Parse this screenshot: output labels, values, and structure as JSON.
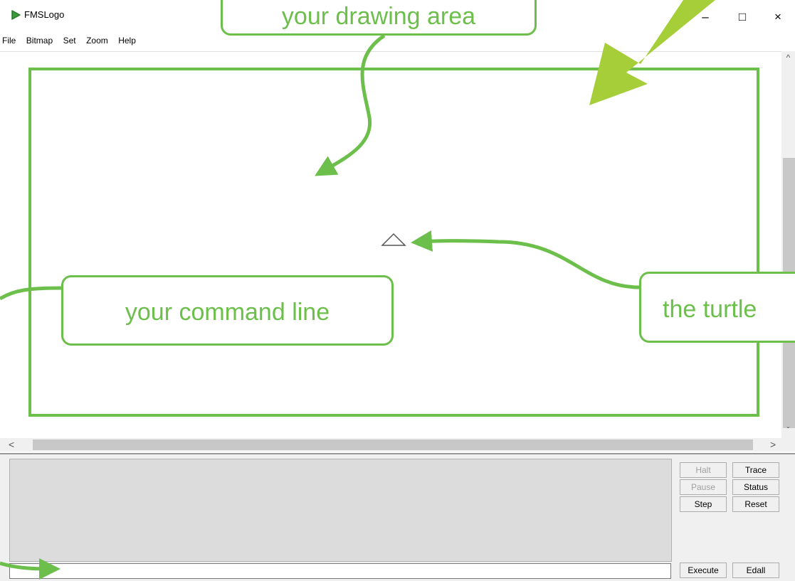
{
  "window": {
    "title": "FMSLogo",
    "controls": {
      "minimize": "–",
      "maximize": "□",
      "close": "×"
    }
  },
  "menu": [
    "File",
    "Bitmap",
    "Set",
    "Zoom",
    "Help"
  ],
  "scrollbars": {
    "up": "^",
    "down": "ˇ",
    "left": "<",
    "right": ">"
  },
  "commander": {
    "input_value": "",
    "buttons": {
      "halt": "Halt",
      "trace": "Trace",
      "pause": "Pause",
      "status": "Status",
      "step": "Step",
      "reset": "Reset",
      "execute": "Execute",
      "edall": "Edall"
    }
  },
  "annotations": {
    "drawing_area": "your drawing area",
    "command_line": "your command line",
    "turtle": "the turtle"
  },
  "colors": {
    "annotation_green": "#6cbf4b",
    "arrow_green": "#a6ce39",
    "logo_green": "#3c9a3c"
  },
  "icons": [
    "fmslogo-logo-icon",
    "turtle-icon",
    "annotation-arrow-icon"
  ]
}
